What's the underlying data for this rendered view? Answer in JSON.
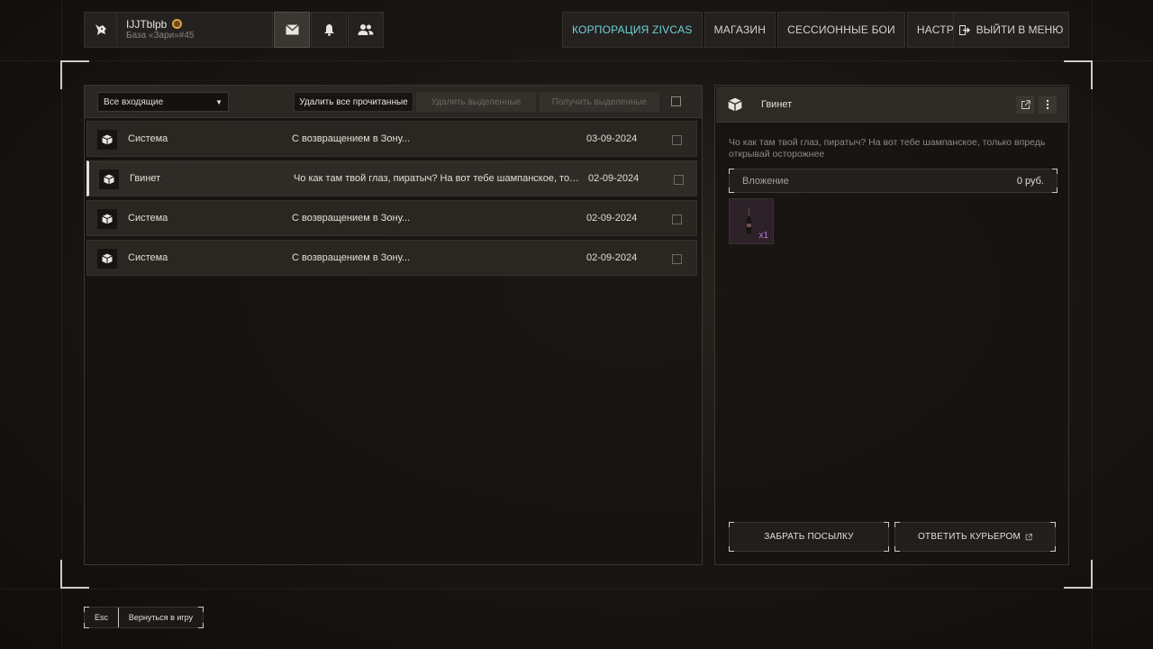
{
  "profile": {
    "nickname": "IJJTblpb",
    "base": "База «Зари»#45",
    "avatar_icon": "wolf-head-icon",
    "rank_icon": "rank-badge-icon"
  },
  "top_icons": [
    "mail-icon",
    "bell-icon",
    "friends-icon"
  ],
  "nav": {
    "tabs": [
      {
        "label": "КОРПОРАЦИЯ ZIVCAS",
        "active": true
      },
      {
        "label": "МАГАЗИН",
        "active": false
      },
      {
        "label": "СЕССИОННЫЕ БОИ",
        "active": false
      },
      {
        "label": "НАСТРОЙКИ",
        "active": false
      }
    ],
    "exit_label": "ВЫЙТИ В МЕНЮ",
    "accent_color": "#6fd0d8"
  },
  "inbox": {
    "filter_value": "Все входящие",
    "delete_read_label": "Удалить все прочитанные",
    "delete_selected_label": "Удалить выделенные",
    "receive_selected_label": "Получить выделенные",
    "messages": [
      {
        "sender": "Система",
        "subject": "С возвращением в Зону...",
        "date": "03-09-2024",
        "selected": false
      },
      {
        "sender": "Гвинет",
        "subject": "Чо как там твой глаз, пиратыч? На вот тебе шампанское, только впредь открывай осторожнее",
        "date": "02-09-2024",
        "selected": true
      },
      {
        "sender": "Система",
        "subject": "С возвращением в Зону...",
        "date": "02-09-2024",
        "selected": false
      },
      {
        "sender": "Система",
        "subject": "С возвращением в Зону...",
        "date": "02-09-2024",
        "selected": false
      }
    ]
  },
  "detail": {
    "sender": "Гвинет",
    "text": "Чо как там твой глаз, пиратыч? На вот тебе шампанское, только впредь открывай осторожнее",
    "attachment_label": "Вложение",
    "attachment_value": "0 руб.",
    "item_qty": "x1",
    "take_label": "ЗАБРАТЬ ПОСЫЛКУ",
    "reply_label": "ОТВЕТИТЬ КУРЬЕРОМ"
  },
  "footer": {
    "key": "Esc",
    "label": "Вернуться в игру"
  }
}
